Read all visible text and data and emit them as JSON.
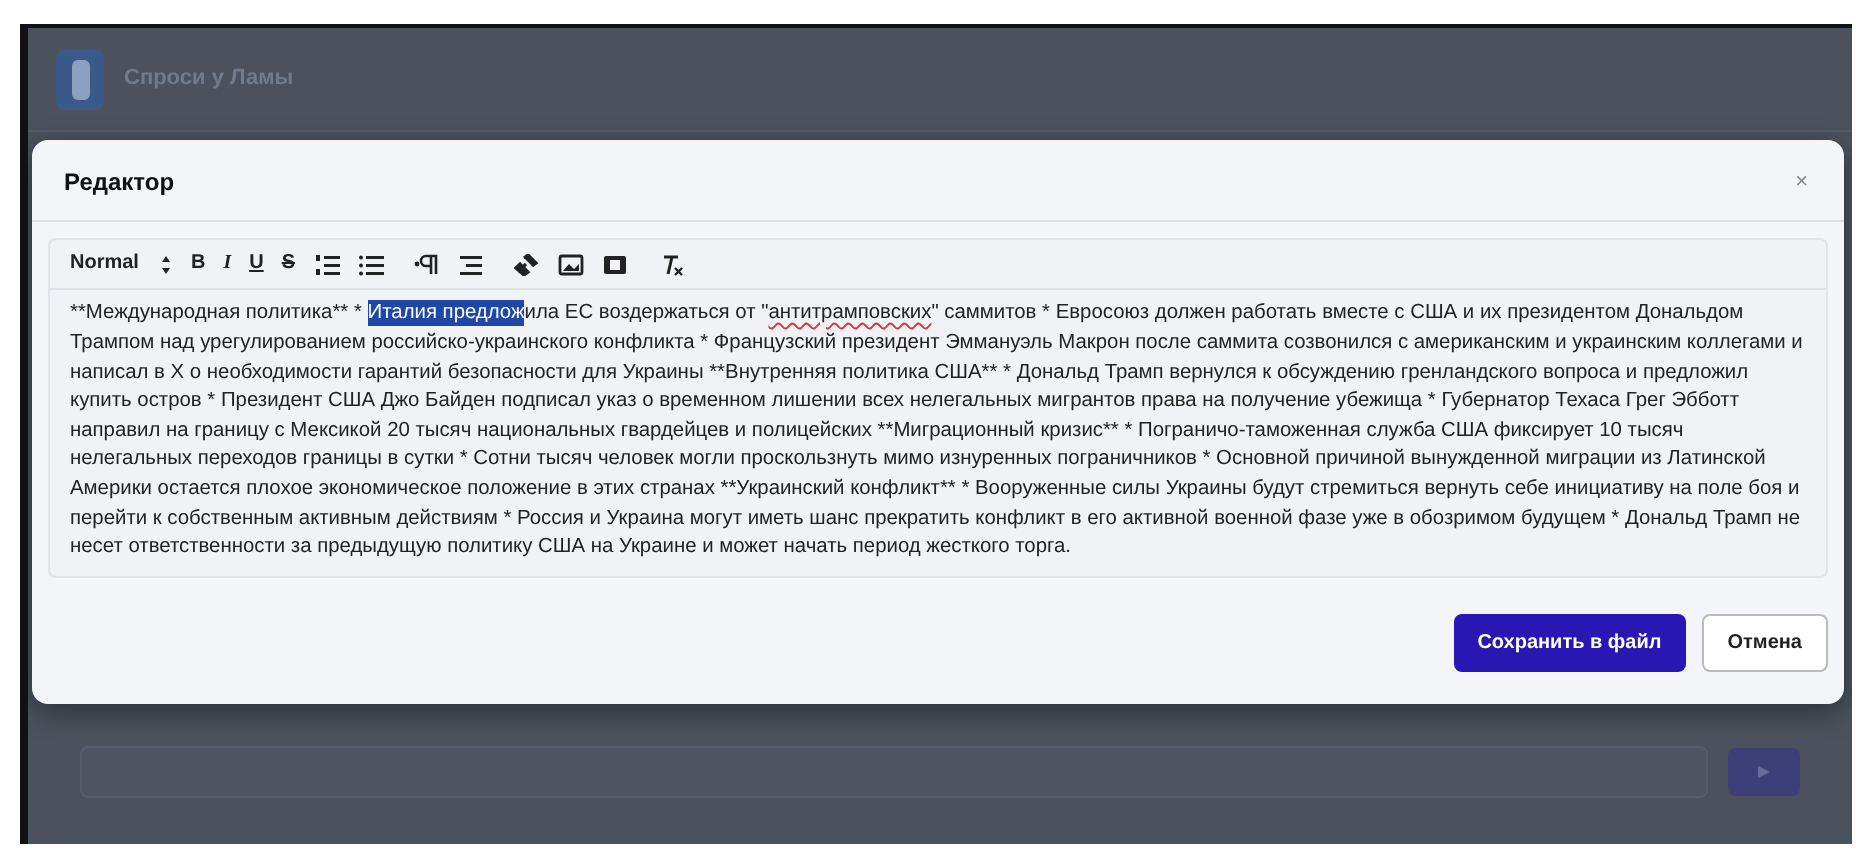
{
  "app": {
    "title": "Спроси у Ламы"
  },
  "modal": {
    "title": "Редактор",
    "close": "×"
  },
  "toolbar": [
    {
      "kind": "dropdown",
      "label": "Normal"
    },
    {
      "kind": "bold",
      "label": "B"
    },
    {
      "kind": "italic",
      "label": "I"
    },
    {
      "kind": "underline",
      "label": "U"
    },
    {
      "kind": "strike",
      "label": "S"
    }
  ],
  "editor": {
    "text_before": "**Международная политика** * ",
    "selection": "Италия предлож",
    "text_middle": "ила ЕС воздержаться от \"",
    "misspelled": "антитрамповских",
    "text_after": "\" саммитов * Евросоюз должен работать вместе с США и их президентом Дональдом Трампом над урегулированием российско-украинского конфликта * Французский президент Эммануэль Макрон после саммита созвонился с американским и украинским коллегами и написал в X о необходимости гарантий безопасности для Украины **Внутренняя политика США** * Дональд Трамп вернулся к обсуждению гренландского вопроса и предложил купить остров * Президент США Джо Байден подписал указ о временном лишении всех нелегальных мигрантов права на получение убежища * Губернатор Техаса Грег Эбботт направил на границу с Мексикой 20 тысяч национальных гвардейцев и полицейских **Миграционный кризис** * Пограничо-таможенная служба США фиксирует 10 тысяч нелегальных переходов границы в сутки * Сотни тысяч человек могли проскользнуть мимо изнуренных пограничников * Основной причиной вынужденной миграции из Латинской Америки остается плохое экономическое положение в этих странах **Украинский конфликт** * Вооруженные силы Украины будут стремиться вернуть себе инициативу на поле боя и перейти к собственным активным действиям * Россия и Украина могут иметь шанс прекратить конфликт в его активной военной фазе уже в обозримом будущем * Дональд Трамп не несет ответственности за предыдущую политику США на Украине и может начать период жесткого торга."
  },
  "buttons": [
    {
      "kind": "primary",
      "label": "Сохранить в файл"
    },
    {
      "kind": "secondary",
      "label": "Отмена"
    }
  ]
}
